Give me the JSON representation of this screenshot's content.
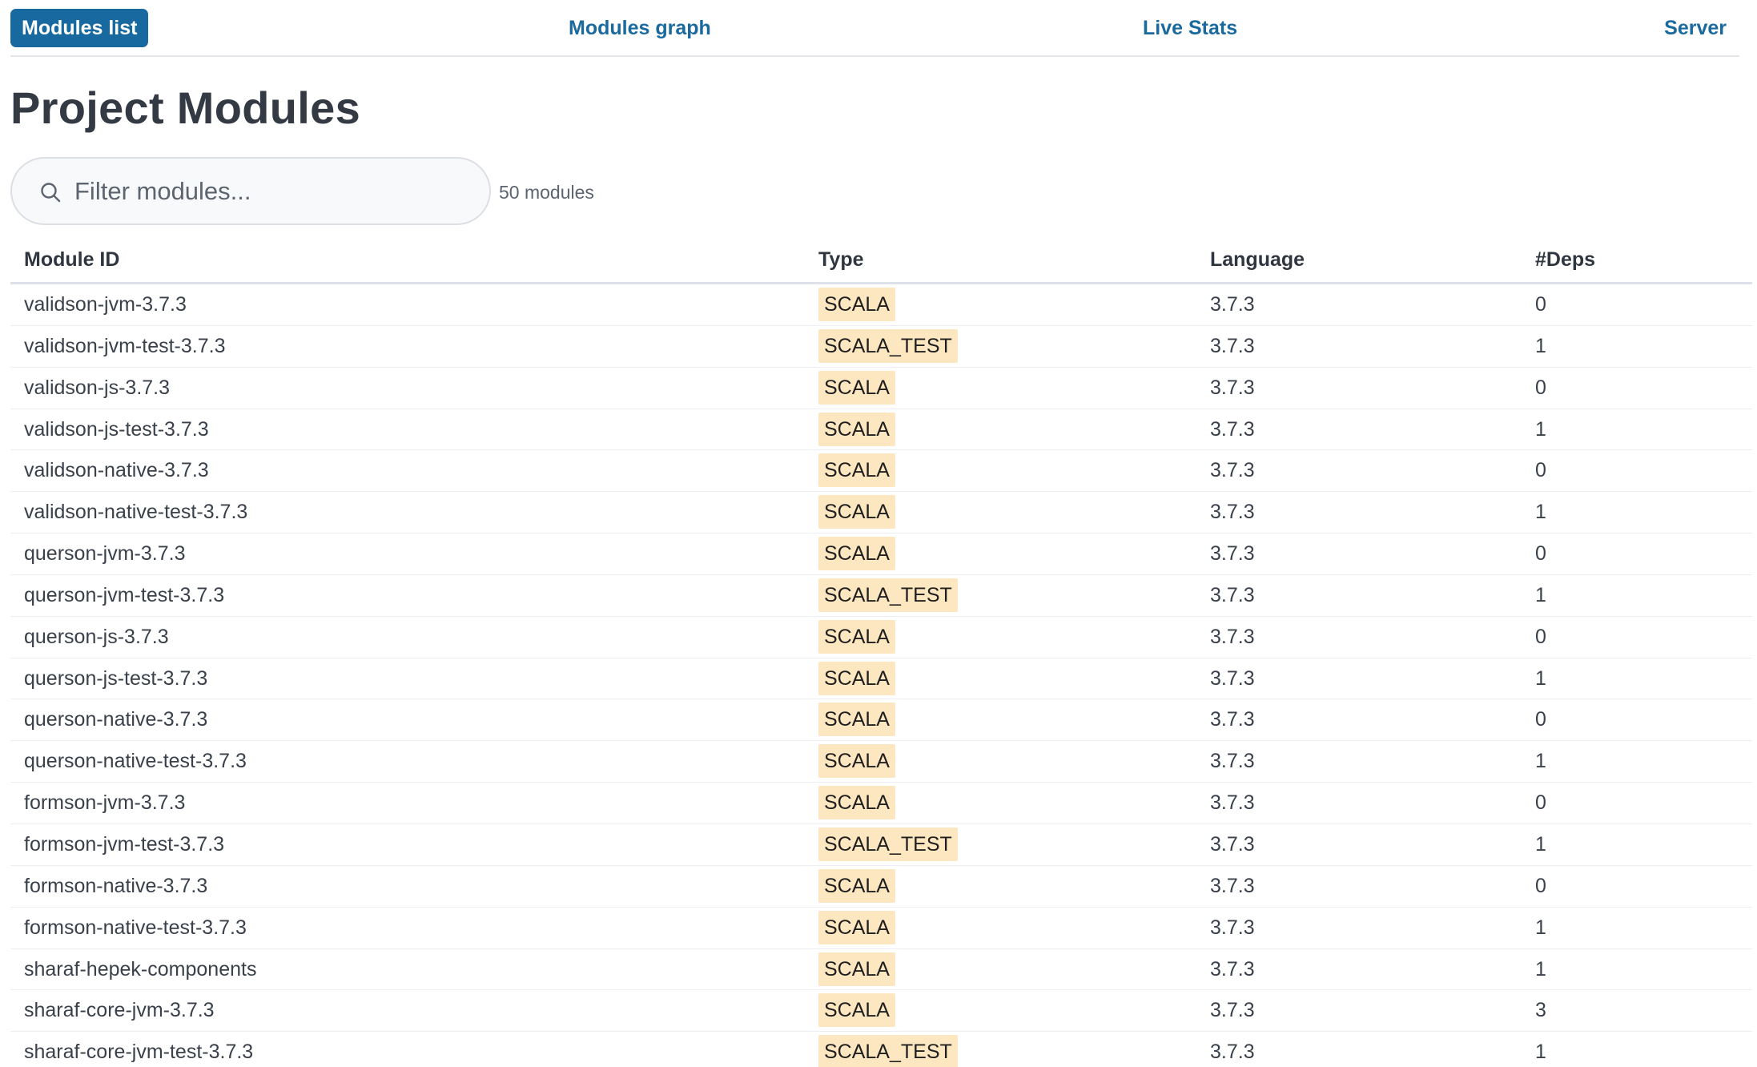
{
  "nav": {
    "items": [
      {
        "label": "Modules list",
        "active": true
      },
      {
        "label": "Modules graph",
        "active": false
      },
      {
        "label": "Live Stats",
        "active": false
      },
      {
        "label": "Server",
        "active": false
      }
    ]
  },
  "page_title": "Project Modules",
  "search": {
    "placeholder": "Filter modules...",
    "value": "",
    "icon": "search-icon"
  },
  "module_count": "50 modules",
  "table": {
    "headers": [
      "Module ID",
      "Type",
      "Language",
      "#Deps"
    ],
    "rows": [
      {
        "id": "validson-jvm-3.7.3",
        "type": "SCALA",
        "language": "3.7.3",
        "deps": "0"
      },
      {
        "id": "validson-jvm-test-3.7.3",
        "type": "SCALA_TEST",
        "language": "3.7.3",
        "deps": "1"
      },
      {
        "id": "validson-js-3.7.3",
        "type": "SCALA",
        "language": "3.7.3",
        "deps": "0"
      },
      {
        "id": "validson-js-test-3.7.3",
        "type": "SCALA",
        "language": "3.7.3",
        "deps": "1"
      },
      {
        "id": "validson-native-3.7.3",
        "type": "SCALA",
        "language": "3.7.3",
        "deps": "0"
      },
      {
        "id": "validson-native-test-3.7.3",
        "type": "SCALA",
        "language": "3.7.3",
        "deps": "1"
      },
      {
        "id": "querson-jvm-3.7.3",
        "type": "SCALA",
        "language": "3.7.3",
        "deps": "0"
      },
      {
        "id": "querson-jvm-test-3.7.3",
        "type": "SCALA_TEST",
        "language": "3.7.3",
        "deps": "1"
      },
      {
        "id": "querson-js-3.7.3",
        "type": "SCALA",
        "language": "3.7.3",
        "deps": "0"
      },
      {
        "id": "querson-js-test-3.7.3",
        "type": "SCALA",
        "language": "3.7.3",
        "deps": "1"
      },
      {
        "id": "querson-native-3.7.3",
        "type": "SCALA",
        "language": "3.7.3",
        "deps": "0"
      },
      {
        "id": "querson-native-test-3.7.3",
        "type": "SCALA",
        "language": "3.7.3",
        "deps": "1"
      },
      {
        "id": "formson-jvm-3.7.3",
        "type": "SCALA",
        "language": "3.7.3",
        "deps": "0"
      },
      {
        "id": "formson-jvm-test-3.7.3",
        "type": "SCALA_TEST",
        "language": "3.7.3",
        "deps": "1"
      },
      {
        "id": "formson-native-3.7.3",
        "type": "SCALA",
        "language": "3.7.3",
        "deps": "0"
      },
      {
        "id": "formson-native-test-3.7.3",
        "type": "SCALA",
        "language": "3.7.3",
        "deps": "1"
      },
      {
        "id": "sharaf-hepek-components",
        "type": "SCALA",
        "language": "3.7.3",
        "deps": "1"
      },
      {
        "id": "sharaf-core-jvm-3.7.3",
        "type": "SCALA",
        "language": "3.7.3",
        "deps": "3"
      },
      {
        "id": "sharaf-core-jvm-test-3.7.3",
        "type": "SCALA_TEST",
        "language": "3.7.3",
        "deps": "1"
      }
    ]
  },
  "colors": {
    "accent": "#1769a0",
    "nav_link": "#1a6a9e",
    "badge_bg": "#fde7c0"
  }
}
